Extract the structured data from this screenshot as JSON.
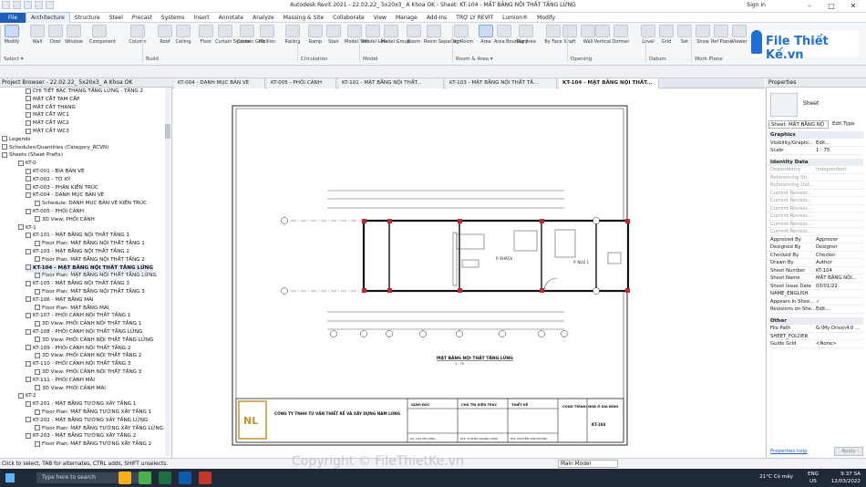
{
  "window": {
    "title": "Autodesk Revit 2021 - 22.02.22_ 5x20x3_ A Khoa OK - Sheet: KT-104 - MẶT BẰNG NỘI THẤT TẦNG LỬNG",
    "sign_in": "Sign In"
  },
  "menu": [
    "File",
    "Architecture",
    "Structure",
    "Steel",
    "Precast",
    "Systems",
    "Insert",
    "Annotate",
    "Analyze",
    "Massing & Site",
    "Collaborate",
    "View",
    "Manage",
    "Add-Ins",
    "TRỢ LÝ REVIT",
    "Lumion®",
    "Modify"
  ],
  "ribbon": {
    "tools": [
      "Modify",
      "Wall",
      "Door",
      "Window",
      "Component",
      "Column",
      "Roof",
      "Ceiling",
      "Floor",
      "Curtain System",
      "Curtain Grid",
      "Mullion",
      "Railing",
      "Ramp",
      "Stair",
      "Model Text",
      "Model Line",
      "Model Group",
      "Room",
      "Room Separator",
      "Tag Room",
      "Area",
      "Area Boundary",
      "Tag Area",
      "By Face",
      "Shaft",
      "Wall",
      "Vertical",
      "Dormer",
      "Level",
      "Grid",
      "Set",
      "Show",
      "Ref Plane",
      "Viewer"
    ],
    "groups": [
      "Select ▾",
      "Build",
      "Circulation",
      "Model",
      "Room & Area ▾",
      "Opening",
      "Datum",
      "Work Plane"
    ]
  },
  "logo": "File Thiết Kế.vn",
  "project_browser": {
    "title": "Project Browser - 22.02.22_ 5x20x3_ A Khoa OK",
    "items": [
      "CHI TIẾT BẬC THANG TẦNG LỬNG - TẦNG 2",
      "MẶT CẮT TAM CẤP",
      "MẶT CẮT THANG",
      "MẶT CẮT WC1",
      "MẶT CẮT WC2",
      "MẶT CẮT WC3",
      "Legends",
      "Schedules/Quantities (Category_RCVN)",
      "Sheets (Sheet Prefix)",
      "KT-0",
      "KT-001 - BÌA BẢN VẼ",
      "KT-002 - TỜ KÝ",
      "KT-003 - PHÂN KIẾN TRÚC",
      "KT-004 - DANH MỤC BẢN VẼ",
      "Schedule: DANH MỤC BẢN VẼ KIẾN TRÚC",
      "KT-005 - PHỐI CẢNH",
      "3D View: PHỐI CẢNH",
      "KT-1",
      "KT-101 - MẶT BẰNG NỘI THẤT TẦNG 1",
      "Floor Plan: MẶT BẰNG NỘI THẤT TẦNG 1",
      "KT-103 - MẶT BẰNG NỘI THẤT TẦNG 2",
      "Floor Plan: MẶT BẰNG NỘI THẤT TẦNG 2",
      "KT-104 - MẶT BẰNG NỘI THẤT TẦNG LỬNG",
      "Floor Plan: MẶT BẰNG NỘI THẤT TẦNG LỬNG",
      "KT-105 - MẶT BẰNG NỘI THẤT TẦNG 3",
      "Floor Plan: MẶT BẰNG NỘI THẤT TẦNG 3",
      "KT-106 - MẶT BẰNG MÁI",
      "Floor Plan: MẶT BẰNG MÁI",
      "KT-107 - PHỐI CẢNH NỘI THẤT TẦNG 1",
      "3D View: PHỐI CẢNH NỘI THẤT TẦNG 1",
      "KT-108 - PHỐI CẢNH NỘI THẤT TẦNG LỬNG",
      "3D View: PHỐI CẢNH NỘI THẤT TẦNG LỬNG",
      "KT-109 - PHỐI CẢNH NỘI THẤT TẦNG 2",
      "3D View: PHỐI CẢNH NỘI THẤT TẦNG 2",
      "KT-110 - PHỐI CẢNH NỘI THẤT TẦNG 3",
      "3D View: PHỐI CẢNH NỘI THẤT TẦNG 3",
      "KT-111 - PHỐI CẢNH MÁI",
      "3D View: PHỐI CẢNH MÁI",
      "KT-2",
      "KT-201 - MẶT BẰNG TƯỜNG XÂY TẦNG 1",
      "Floor Plan: MẶT BẰNG TƯỜNG XÂY TẦNG 1",
      "KT-202 - MẶT BẰNG TƯỜNG XÂY TẦNG LỬNG",
      "Floor Plan: MẶT BẰNG TƯỜNG XÂY TẦNG LỬNG",
      "KT-203 - MẶT BẰNG TƯỜNG XÂY TẦNG 2",
      "Floor Plan: MẶT BẰNG TƯỜNG XÂY TẦNG 2"
    ]
  },
  "doc_tabs": [
    "KT-004 - DANH MỤC BẢN VẼ",
    "KT-005 - PHỐI CẢNH",
    "KT-101 - MẶT BẰNG NỘI THẤT...",
    "KT-103 - MẶT BẰNG NỘI THẤT TẦ...",
    "KT-104 - MẶT BẰNG NỘI THẤT..."
  ],
  "sheet": {
    "plan_title": "MẶT BẰNG NỘI THẤT TẦNG LỬNG",
    "scale": "1 : 75",
    "rooms": [
      "P. KHÁCH",
      "P. NGỦ 1"
    ],
    "grids": [
      "1",
      "2",
      "3",
      "4",
      "5",
      "6",
      "7",
      "8",
      "A",
      "B"
    ],
    "company": "CÔNG TY TNHH TƯ VẤN THIẾT KẾ VÀ XÂY DỰNG NAM LONG",
    "roles": [
      "GIÁM ĐỐC",
      "CHỦ TRÌ KIẾN TRÚC",
      "THIẾT KẾ"
    ],
    "names": [
      "KS. CAO PHI LONG",
      "KTS. VƯƠNG HOÀNG LONG",
      "KTS. NGUYỄN VĂN DƯƠNG"
    ],
    "project": "CÔNG TRÌNH: NHÀ Ở GIA ĐÌNH",
    "sheet_no": "KT-104"
  },
  "properties": {
    "title": "Properties",
    "family": "Sheet",
    "selector": "Sheet: MẶT BẰNG NỘ",
    "edit_type": "Edit Type",
    "sections": [
      "Graphics",
      "Identity Data",
      "Other"
    ],
    "rows": [
      [
        "Visibility/Graphi...",
        "Edit..."
      ],
      [
        "Scale",
        "1 : 75"
      ],
      [
        "Dependency",
        "Independent"
      ],
      [
        "Referencing Sh...",
        ""
      ],
      [
        "Referencing Det...",
        ""
      ],
      [
        "Current Revisio...",
        ""
      ],
      [
        "Current Revisio...",
        ""
      ],
      [
        "Current Revisio...",
        ""
      ],
      [
        "Current Revisio...",
        ""
      ],
      [
        "Current Revisio...",
        ""
      ],
      [
        "Current Revisio...",
        ""
      ],
      [
        "Approved By",
        "Approver"
      ],
      [
        "Designed By",
        "Designer"
      ],
      [
        "Checked By",
        "Checker"
      ],
      [
        "Drawn By",
        "Author"
      ],
      [
        "Sheet Number",
        "KT-104"
      ],
      [
        "Sheet Name",
        "MẶT BẰNG NỘI..."
      ],
      [
        "Sheet Issue Date",
        "03/01/22"
      ],
      [
        "NAME_ENGLISH",
        ""
      ],
      [
        "Appears In Shee...",
        "✓"
      ],
      [
        "Revisions on She...",
        "Edit..."
      ],
      [
        "File Path",
        "G:\\My Drive\\4.0 ..."
      ],
      [
        "SHEET_FOLDER",
        ""
      ],
      [
        "Guide Grid",
        "<None>"
      ]
    ],
    "help": "Properties help",
    "apply": "Apply"
  },
  "status": {
    "text": "Click to select, TAB for alternates, CTRL adds, SHIFT unselects.",
    "model": "Main Model"
  },
  "watermark": "Copyright © FileThietKe.vn",
  "taskbar": {
    "search": "Type here to search",
    "weather": "21°C  Có mây",
    "lang": "ENG",
    "lang2": "US",
    "time": "9:37 SA",
    "date": "12/03/2022"
  }
}
